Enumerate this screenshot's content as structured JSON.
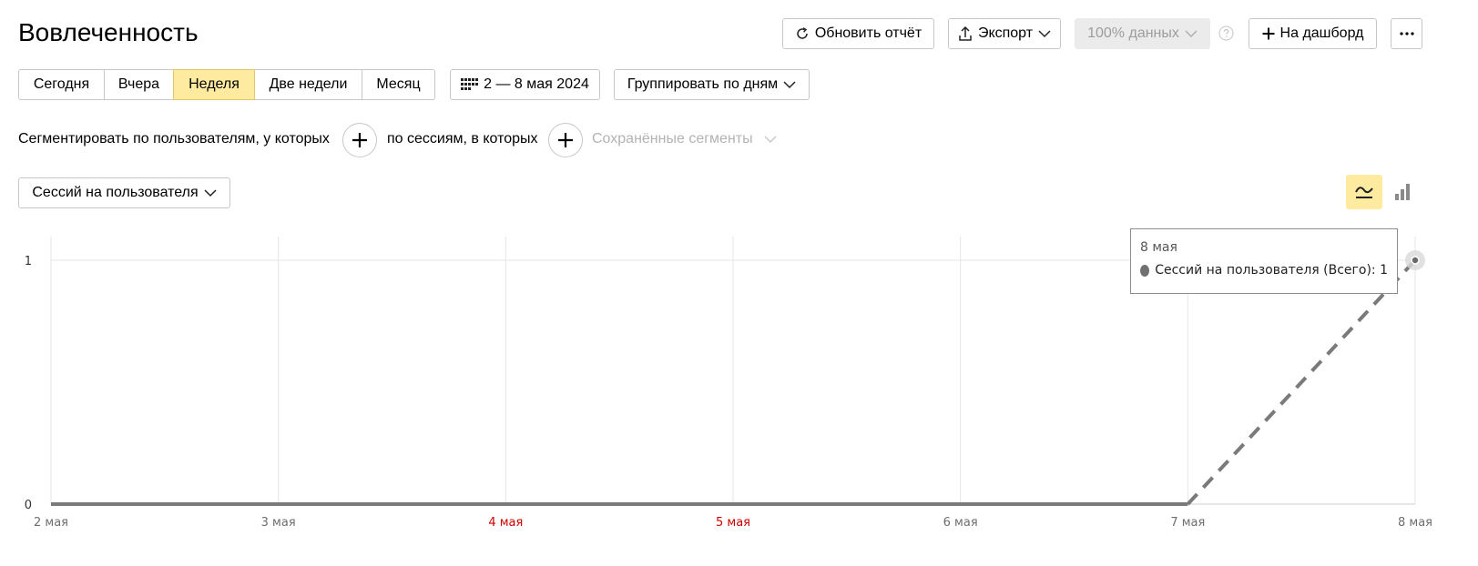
{
  "header": {
    "title": "Вовлеченность",
    "refresh_label": "Обновить отчёт",
    "export_label": "Экспорт",
    "sampling_label": "100% данных",
    "dashboard_label": "На дашборд"
  },
  "period": {
    "tabs": [
      {
        "label": "Сегодня"
      },
      {
        "label": "Вчера"
      },
      {
        "label": "Неделя",
        "active": true
      },
      {
        "label": "Две недели"
      },
      {
        "label": "Месяц"
      }
    ],
    "date_range": "2 — 8 мая 2024",
    "grouping": "Группировать по дням"
  },
  "segments": {
    "users_label": "Сегментировать по пользователям, у которых",
    "sessions_label": "по сессиям, в которых",
    "saved_label": "Сохранённые сегменты"
  },
  "metric_select": {
    "value": "Сессий на пользователя"
  },
  "colors": {
    "accent": "#ffeba0",
    "weekend_tick": "#cc0000",
    "series_line": "#7a7a7a"
  },
  "chart_data": {
    "type": "line",
    "x": [
      "2 мая",
      "3 мая",
      "4 мая",
      "5 мая",
      "6 мая",
      "7 мая",
      "8 мая"
    ],
    "weekend_ticks": [
      "4 мая",
      "5 мая"
    ],
    "series": [
      {
        "name": "Сессий на пользователя (Всего)",
        "values": [
          0,
          0,
          0,
          0,
          0,
          0,
          1
        ],
        "incomplete_from": "7 мая"
      }
    ],
    "yticks": [
      0,
      1
    ],
    "ylim": [
      0,
      1
    ],
    "grid": true,
    "tooltip": {
      "date": "8 мая",
      "text": "Сессий на пользователя (Всего): 1"
    }
  }
}
